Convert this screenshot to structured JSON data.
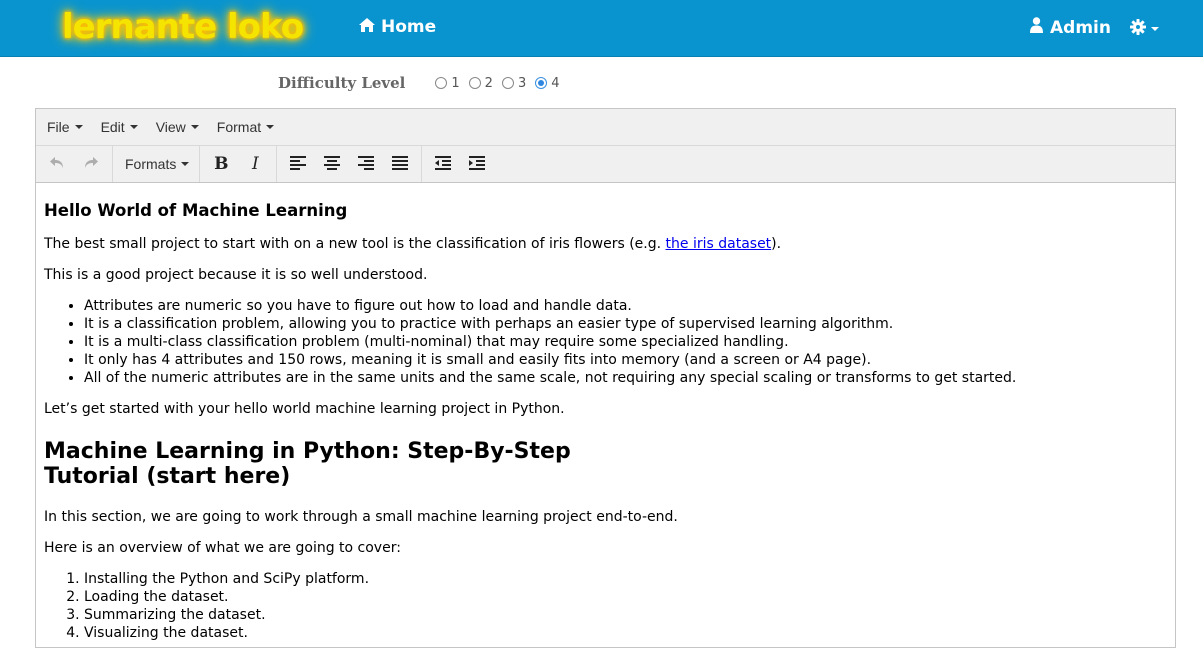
{
  "navbar": {
    "brand": "lernante loko",
    "home_label": "Home",
    "admin_label": "Admin",
    "bg_color": "#0a94cf",
    "brand_color": "#f5e400",
    "home_icon": "home-icon",
    "admin_icon": "user-icon",
    "settings_icon": "gear-icon"
  },
  "difficulty": {
    "label": "Difficulty Level",
    "options": [
      "1",
      "2",
      "3",
      "4"
    ],
    "selected": "4"
  },
  "editor": {
    "menu": [
      "File",
      "Edit",
      "View",
      "Format"
    ],
    "toolbar": {
      "formats_label": "Formats",
      "bold_label": "B",
      "italic_label": "I"
    }
  },
  "content": {
    "heading1": "Hello World of Machine Learning",
    "intro_before": "The best small project to start with on a new tool is the classification of iris flowers (e.g. ",
    "intro_link": "the iris dataset",
    "intro_after": ").",
    "para2": "This is a good project because it is so well understood.",
    "bullets": [
      "Attributes are numeric so you have to figure out how to load and handle data.",
      "It is a classification problem, allowing you to practice with perhaps an easier type of supervised learning algorithm.",
      "It is a multi-class classification problem (multi-nominal) that may require some specialized handling.",
      "It only has 4 attributes and 150 rows, meaning it is small and easily fits into memory (and a screen or A4 page).",
      "All of the numeric attributes are in the same units and the same scale, not requiring any special scaling or transforms to get started."
    ],
    "para3": "Let’s get started with your hello world machine learning project in Python.",
    "heading2": "Machine Learning in Python: Step-By-Step Tutorial (start here)",
    "para4": "In this section, we are going to work through a small machine learning project end-to-end.",
    "para5": "Here is an overview of what we are going to cover:",
    "steps": [
      "Installing the Python and SciPy platform.",
      "Loading the dataset.",
      "Summarizing the dataset.",
      "Visualizing the dataset."
    ]
  }
}
